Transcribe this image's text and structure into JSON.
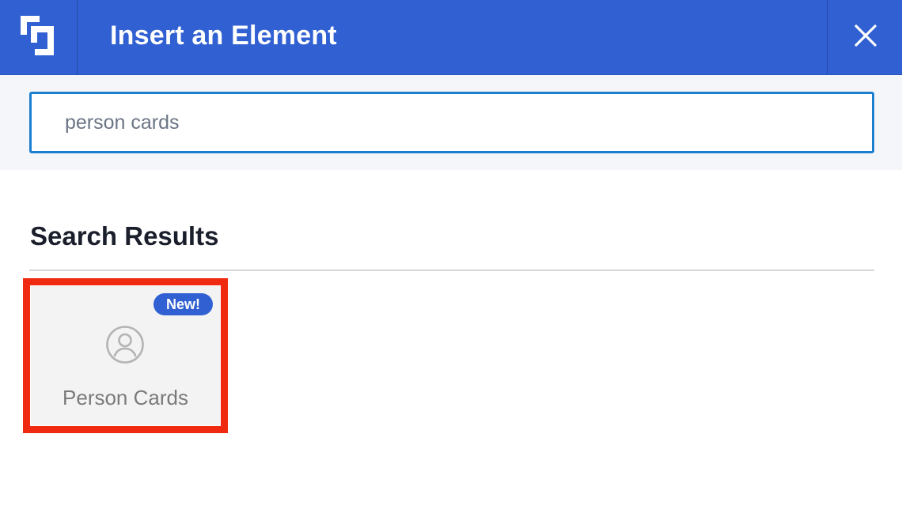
{
  "header": {
    "title": "Insert an Element",
    "logo_icon": "brand-logo-icon",
    "close_icon": "close-icon",
    "color": "#3060d2"
  },
  "search": {
    "value": "person cards",
    "placeholder": "",
    "border_color": "#1b7fce"
  },
  "results": {
    "heading": "Search Results",
    "items": [
      {
        "label": "Person Cards",
        "badge": "New!",
        "icon": "user-circle-icon",
        "highlighted": true,
        "highlight_color": "#f02a10"
      }
    ]
  }
}
